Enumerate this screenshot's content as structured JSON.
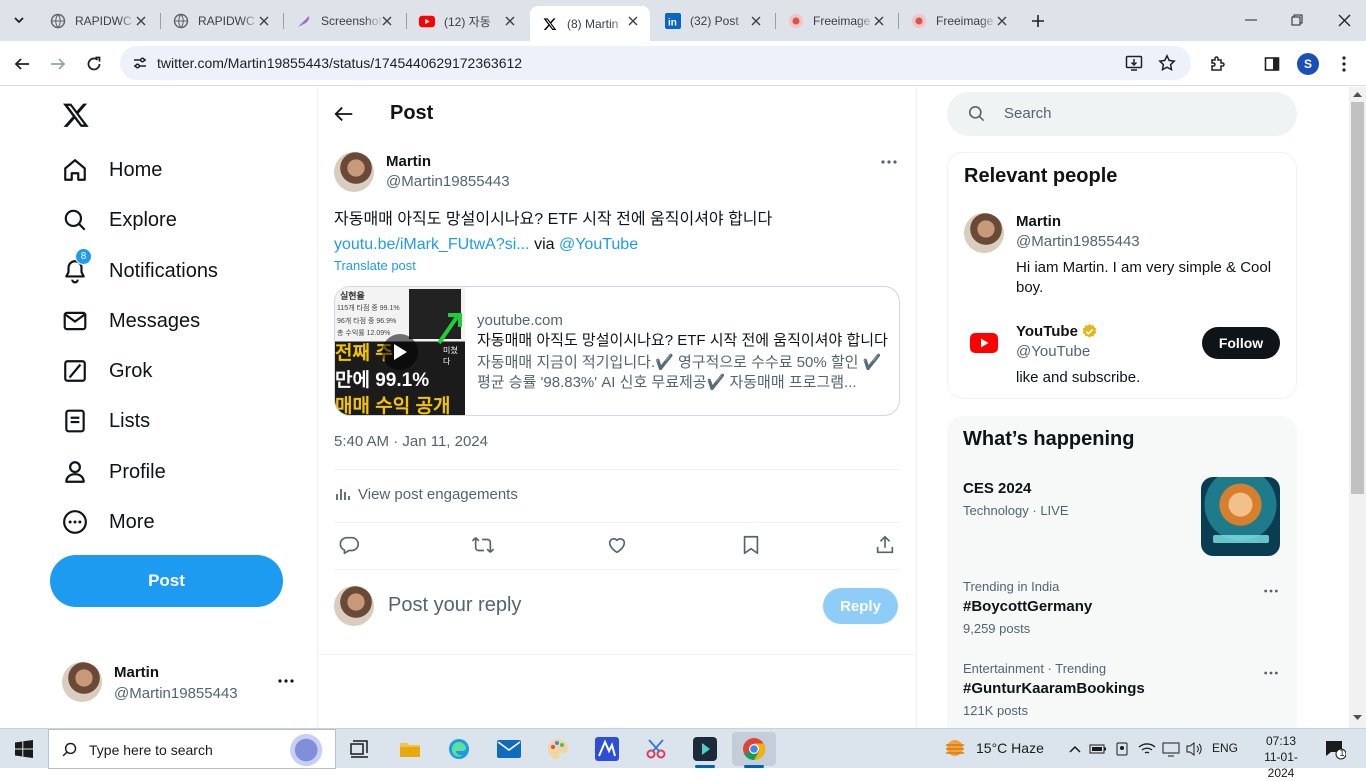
{
  "browser": {
    "tabs": [
      {
        "label": "RAPIDWC",
        "icon": "web-icon"
      },
      {
        "label": "RAPIDWC",
        "icon": "web-icon"
      },
      {
        "label": "Screenshot",
        "icon": "feather-icon"
      },
      {
        "label": "(12) 자동",
        "icon": "youtube-icon"
      },
      {
        "label": "(8) Martin",
        "icon": "x-icon"
      },
      {
        "label": "(32) Post",
        "icon": "linkedin-icon"
      },
      {
        "label": "Freeimage",
        "icon": "freeimage-icon"
      },
      {
        "label": "Freeimage",
        "icon": "freeimage-icon"
      }
    ],
    "url": "twitter.com/Martin19855443/status/1745440629172363612",
    "profile_initial": "S"
  },
  "nav": {
    "items": [
      {
        "label": "Home",
        "icon": "home-icon"
      },
      {
        "label": "Explore",
        "icon": "search-icon"
      },
      {
        "label": "Notifications",
        "icon": "bell-icon"
      },
      {
        "label": "Messages",
        "icon": "envelope-icon"
      },
      {
        "label": "Grok",
        "icon": "grok-icon"
      },
      {
        "label": "Lists",
        "icon": "list-icon"
      },
      {
        "label": "Profile",
        "icon": "person-icon"
      },
      {
        "label": "More",
        "icon": "more-circle-icon"
      }
    ],
    "notifications_badge": "8",
    "post_button": "Post",
    "account": {
      "name": "Martin",
      "handle": "@Martin19855443"
    }
  },
  "main": {
    "title": "Post",
    "post": {
      "author_name": "Martin",
      "author_handle": "@Martin19855443",
      "text": "자동매매 아직도 망설이시나요? ETF 시작 전에 움직이셔야 합니다",
      "link_text": "youtu.be/iMark_FUtwA?si...",
      "via": "via",
      "mention": "@YouTube",
      "translate": "Translate post",
      "card": {
        "domain": "youtube.com",
        "title": "자동매매 아직도 망설이시나요? ETF 시작 전에 움직이셔야 합니다",
        "description": "자동매매 지금이 적기입니다.✔️ 영구적으로 수수료 50% 할인 ✔️ 평균 승률 '98.83%' AI 신호 무료제공✔️ 자동매매 프로그램...",
        "thumb": {
          "top_label": "실현율",
          "line1": "115개 타점 중 99.1%",
          "line2": "96개 타점 중 96.9%",
          "line3": "총 수익률 12.09%",
          "big1": "전째 주",
          "big2": "만에 99.1%",
          "big3": "매매 수익 공개",
          "side_label": "미쳤다"
        }
      },
      "timestamp": "5:40 AM · Jan 11, 2024",
      "engagements": "View post engagements"
    },
    "reply": {
      "placeholder": "Post your reply",
      "button": "Reply"
    }
  },
  "right": {
    "search_placeholder": "Search",
    "relevant": {
      "title": "Relevant people",
      "people": [
        {
          "name": "Martin",
          "handle": "@Martin19855443",
          "bio": "Hi iam Martin. I am very simple & Cool boy."
        },
        {
          "name": "YouTube",
          "handle": "@YouTube",
          "bio": "like and subscribe.",
          "verified": true
        }
      ],
      "follow_label": "Follow"
    },
    "happening": {
      "title": "What’s happening",
      "trends": [
        {
          "context": "Technology · LIVE",
          "name": "CES 2024",
          "count": ""
        },
        {
          "context": "Trending in India",
          "name": "#BoycottGermany",
          "count": "9,259 posts"
        },
        {
          "context": "Entertainment · Trending",
          "name": "#GunturKaaramBookings",
          "count": "121K posts"
        }
      ]
    }
  },
  "taskbar": {
    "search_placeholder": "Type here to search",
    "weather": "15°C  Haze",
    "language": "ENG",
    "time": "07:13",
    "date": "11-01-2024",
    "notification_count": "1"
  },
  "colors": {
    "accent": "#1d9bf0",
    "text": "#0f1419",
    "muted": "#536471",
    "chrome_tabstrip": "#dee3ea"
  }
}
